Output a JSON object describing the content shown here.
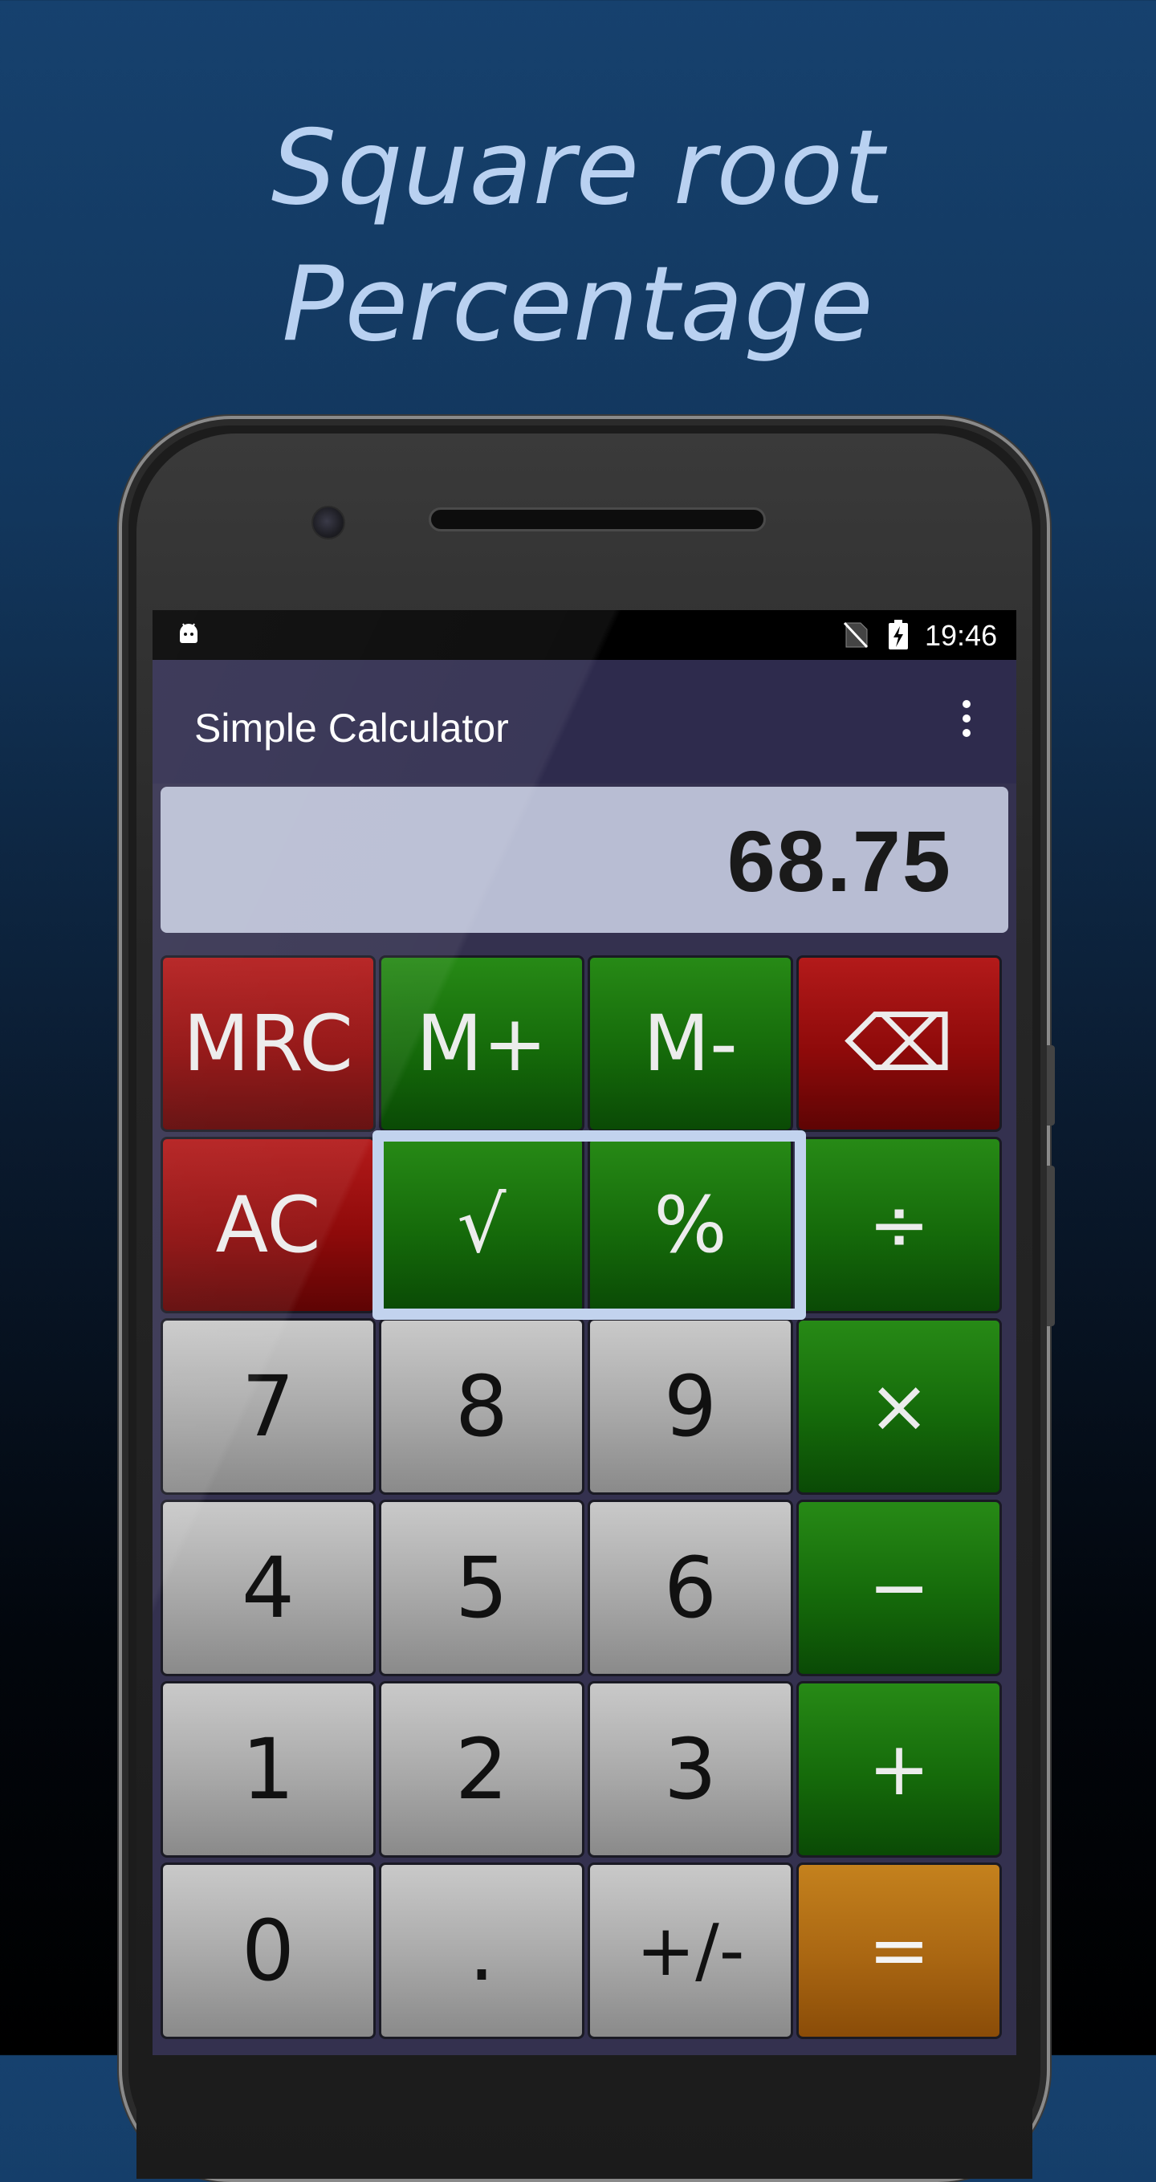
{
  "promo": {
    "line1": "Square root",
    "line2": "Percentage"
  },
  "statusbar": {
    "time": "19:46",
    "icons": [
      "android-debug-icon",
      "no-sim-icon",
      "battery-charging-icon"
    ]
  },
  "appbar": {
    "title": "Simple Calculator",
    "menu_icon": "more-vert-icon"
  },
  "display": {
    "value": "68.75"
  },
  "keys": {
    "mrc": "MRC",
    "mplus": "M+",
    "mminus": "M-",
    "backspace": "⌫",
    "ac": "AC",
    "sqrt": "√",
    "percent": "%",
    "divide": "÷",
    "seven": "7",
    "eight": "8",
    "nine": "9",
    "multiply": "×",
    "four": "4",
    "five": "5",
    "six": "6",
    "minus": "−",
    "one": "1",
    "two": "2",
    "three": "3",
    "plus": "+",
    "zero": "0",
    "dot": ".",
    "negate": "+/-",
    "equals": "="
  },
  "highlighted_keys": [
    "√",
    "%"
  ],
  "colors": {
    "background_top": "#16416e",
    "headline": "#b9d1f1",
    "appbar": "#2e2b4d",
    "display_bg": "#b8bdd3",
    "key_red": "#8e0a0a",
    "key_green": "#156a0a",
    "key_gray": "#a8a8a8",
    "key_orange": "#a96612",
    "highlight_border": "#c2d3ee"
  }
}
